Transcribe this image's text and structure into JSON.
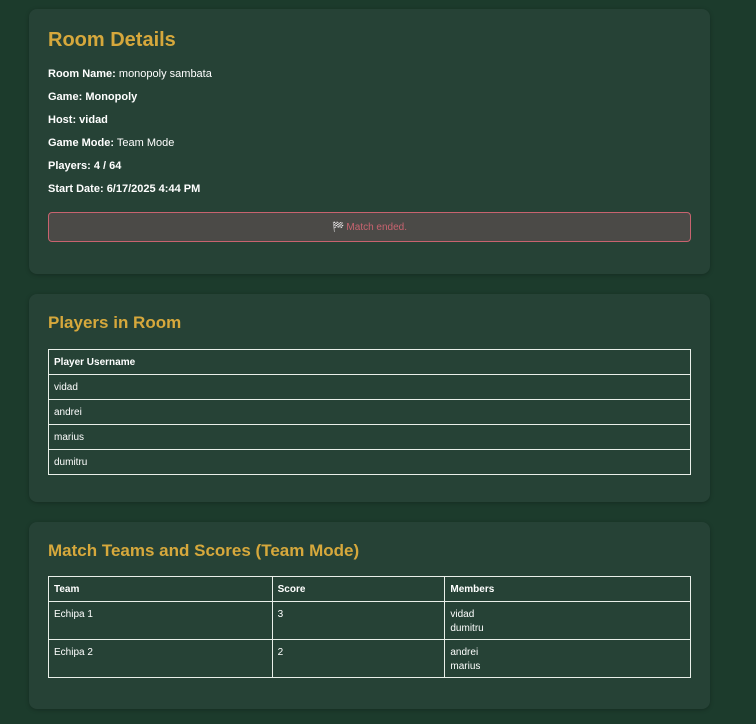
{
  "room": {
    "title": "Room Details",
    "details": [
      {
        "label": "Room Name:",
        "value": "monopoly sambata"
      },
      {
        "label": "Game:",
        "value": "Monopoly"
      },
      {
        "label": "Host:",
        "value": "vidad"
      },
      {
        "label": "Game Mode:",
        "value": "Team Mode"
      },
      {
        "label": "Players:",
        "value": "4 / 64"
      },
      {
        "label": "Start Date:",
        "value": "6/17/2025 4:44 PM"
      }
    ],
    "status": {
      "icon": "🏁",
      "text": "Match ended."
    }
  },
  "players": {
    "title": "Players in Room",
    "header": "Player Username",
    "rows": [
      "vidad",
      "andrei",
      "marius",
      "dumitru"
    ]
  },
  "teams": {
    "title": "Match Teams and Scores (Team Mode)",
    "headers": [
      "Team",
      "Score",
      "Members"
    ],
    "rows": [
      {
        "team": "Echipa 1",
        "score": "3",
        "members": [
          "vidad",
          "dumitru"
        ]
      },
      {
        "team": "Echipa 2",
        "score": "2",
        "members": [
          "andrei",
          "marius"
        ]
      }
    ]
  },
  "colors": {
    "background": "#1c3b2c",
    "card": "#264236",
    "heading": "#d6a83c",
    "status": "#c8636f"
  }
}
